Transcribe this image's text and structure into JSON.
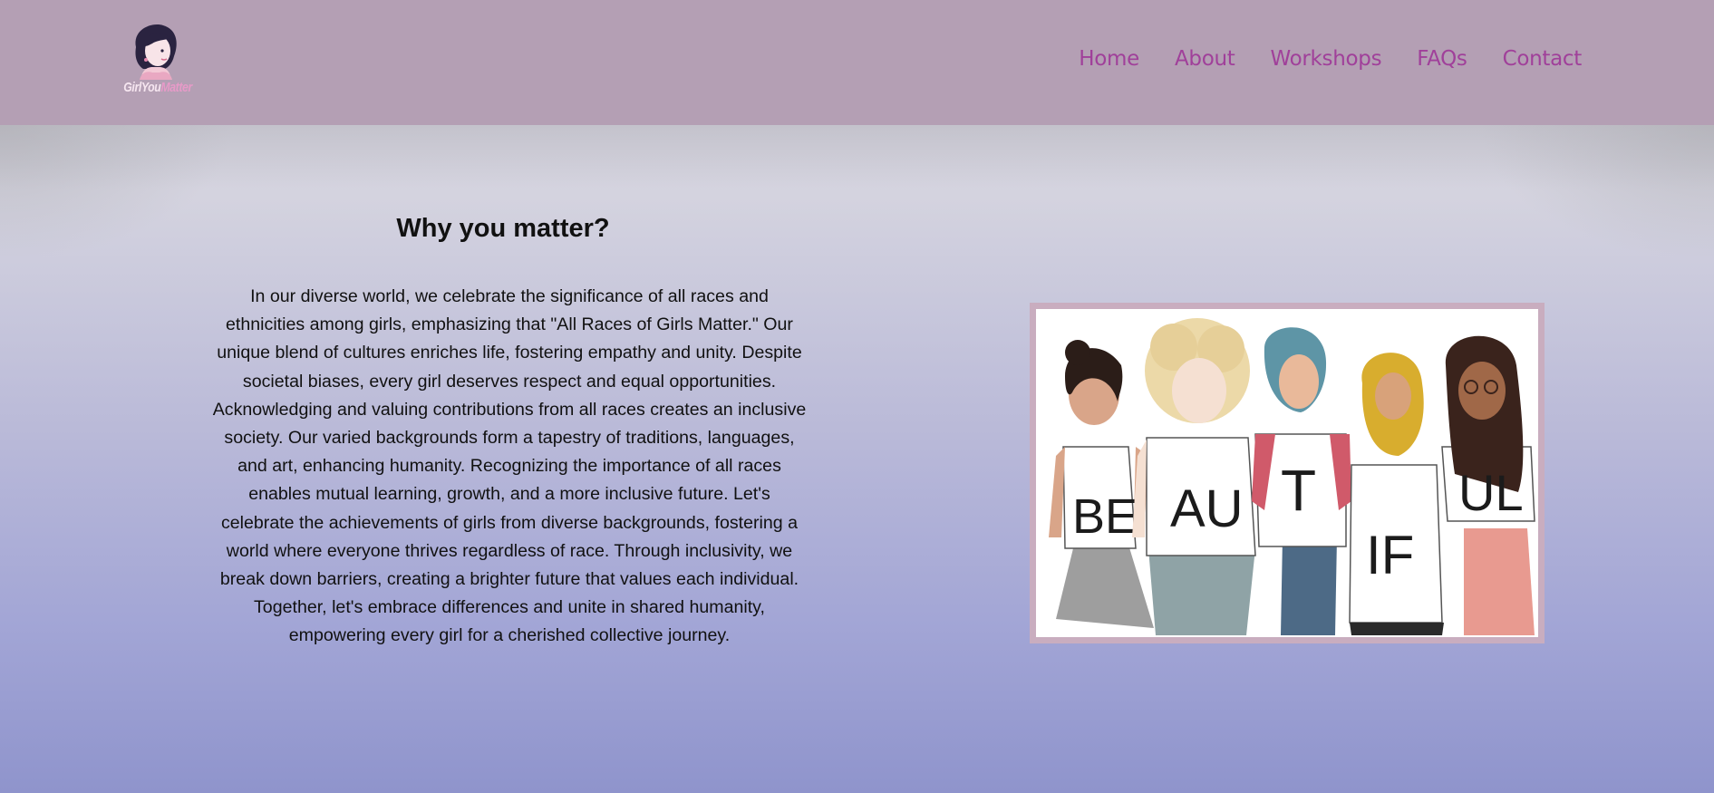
{
  "header": {
    "logo": {
      "icon": "girl-avatar-logo",
      "text_part1": "GirlYou",
      "text_part2": "Matter"
    },
    "nav": [
      {
        "label": "Home"
      },
      {
        "label": "About"
      },
      {
        "label": "Workshops"
      },
      {
        "label": "FAQs"
      },
      {
        "label": "Contact"
      }
    ],
    "background_color": "#b49fb4",
    "link_color": "#a0409a"
  },
  "main": {
    "title": "Why you matter?",
    "body": "In our diverse world, we celebrate the significance of all races and ethnicities among girls, emphasizing that \"All Races of Girls Matter.\" Our unique blend of cultures enriches life, fostering empathy and unity. Despite societal biases, every girl deserves respect and equal opportunities. Acknowledging and valuing contributions from all races creates an inclusive society. Our varied backgrounds form a tapestry of traditions, languages, and art, enhancing humanity. Recognizing the importance of all races enables mutual learning, growth, and a more inclusive future. Let's celebrate the achievements of girls from diverse backgrounds, fostering a world where everyone thrives regardless of race. Through inclusivity, we break down barriers, creating a brighter future that values each individual. Together, let's embrace differences and unite in shared humanity, empowering every girl for a cherished collective journey.",
    "illustration": {
      "shirt_letters": [
        "BE",
        "AU",
        "T",
        "IF",
        "UL"
      ]
    }
  }
}
